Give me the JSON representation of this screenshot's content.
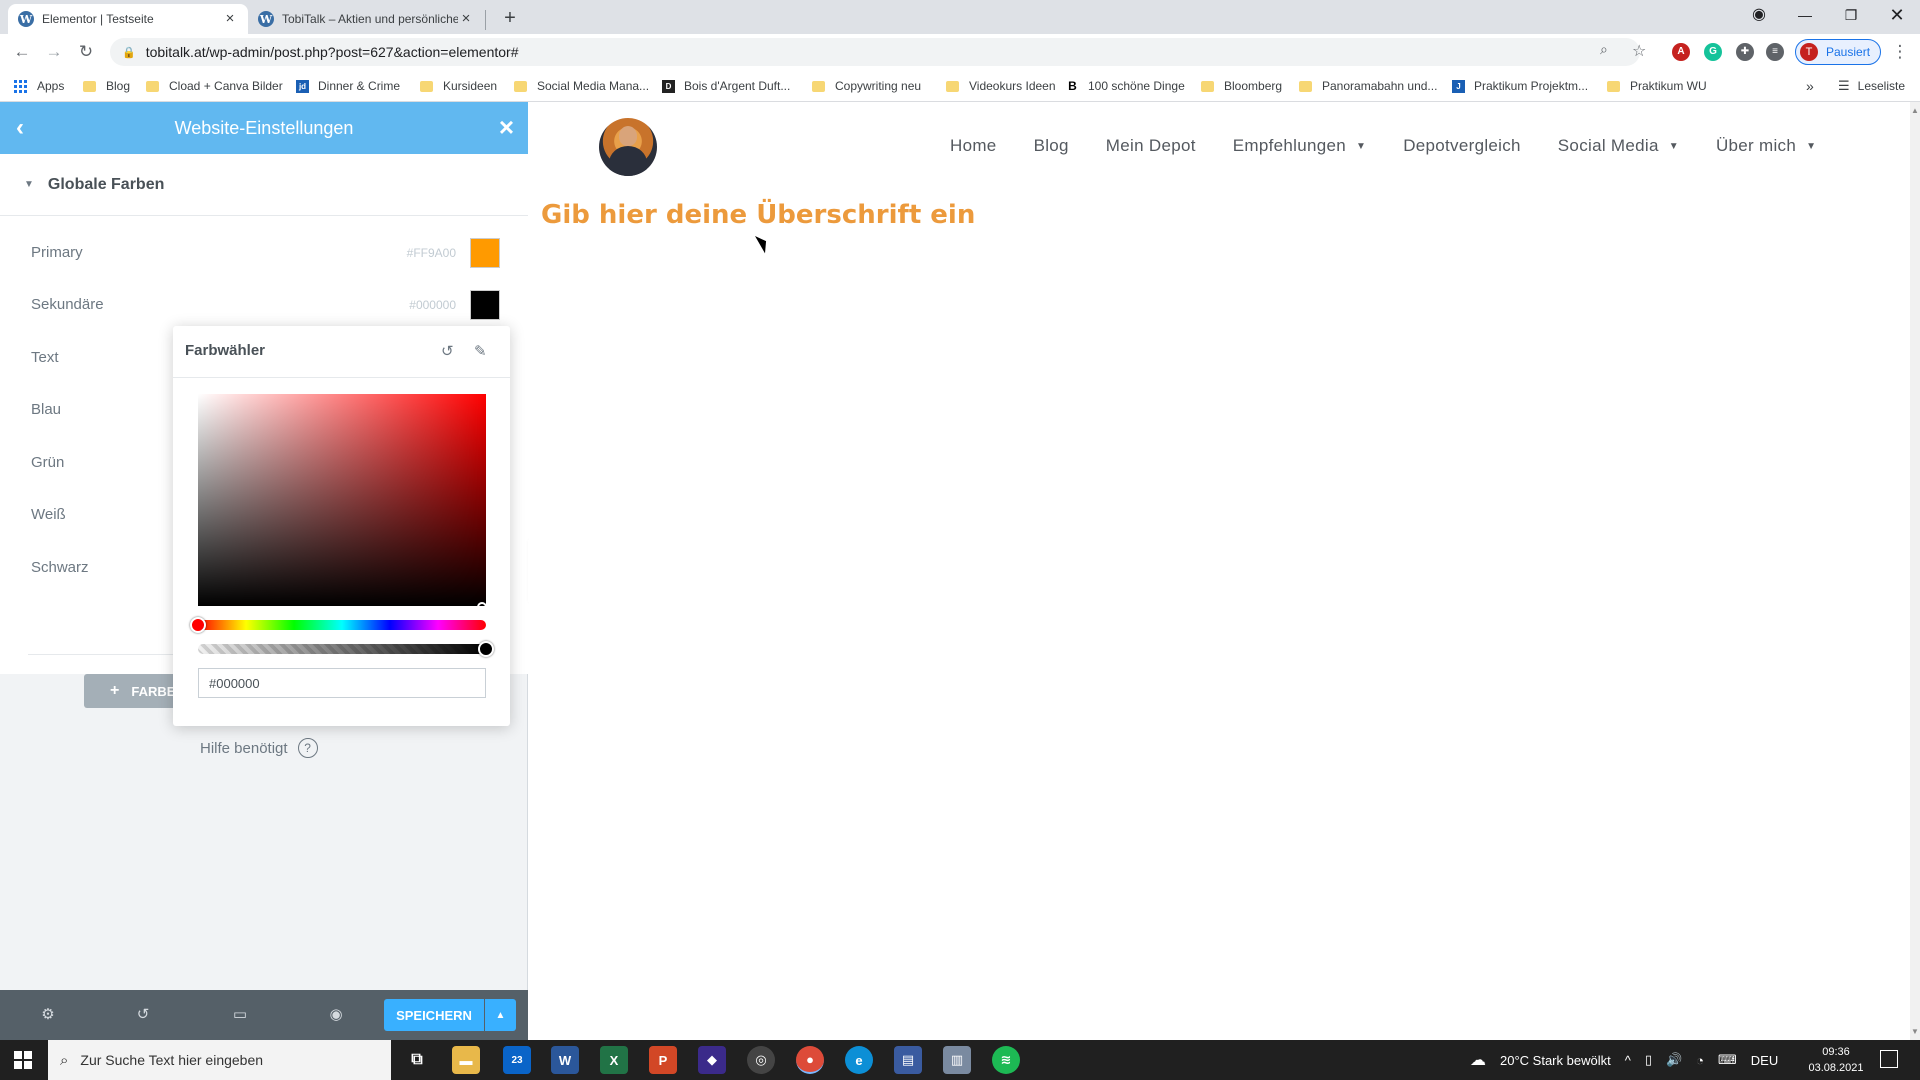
{
  "browser": {
    "tabs": [
      {
        "title": "Elementor | Testseite",
        "active": true
      },
      {
        "title": "TobiTalk – Aktien und persönliche",
        "active": false
      }
    ],
    "new_tab": "+",
    "url": "tobitalk.at/wp-admin/post.php?post=627&action=elementor#",
    "profile_initial": "T",
    "profile_label": "Pausiert",
    "reading_list": "Leseliste",
    "more_bookmarks": "»",
    "bookmarks": [
      {
        "label": "Apps",
        "icon": "apps-grid-icon"
      },
      {
        "label": "Blog",
        "icon": "folder-icon"
      },
      {
        "label": "Cload + Canva Bilder",
        "icon": "folder-icon"
      },
      {
        "label": "Dinner & Crime",
        "icon": "jd-icon"
      },
      {
        "label": "Kursideen",
        "icon": "folder-icon"
      },
      {
        "label": "Social Media Mana...",
        "icon": "folder-icon"
      },
      {
        "label": "Bois d'Argent Duft...",
        "icon": "dior-icon"
      },
      {
        "label": "Copywriting neu",
        "icon": "folder-icon"
      },
      {
        "label": "Videokurs Ideen",
        "icon": "folder-icon"
      },
      {
        "label": "100 schöne Dinge",
        "icon": "b-icon"
      },
      {
        "label": "Bloomberg",
        "icon": "folder-icon"
      },
      {
        "label": "Panoramabahn und...",
        "icon": "folder-icon"
      },
      {
        "label": "Praktikum Projektm...",
        "icon": "j-icon"
      },
      {
        "label": "Praktikum WU",
        "icon": "folder-icon"
      }
    ]
  },
  "panel": {
    "title": "Website-Einstellungen",
    "section_title": "Globale Farben",
    "colors": [
      {
        "name": "Primary",
        "hex": "#FF9A00",
        "swatch": "#FF9A00"
      },
      {
        "name": "Sekundäre",
        "hex": "#000000",
        "swatch": "#000000"
      },
      {
        "name": "Text"
      },
      {
        "name": "Blau"
      },
      {
        "name": "Grün"
      },
      {
        "name": "Weiß"
      },
      {
        "name": "Schwarz"
      }
    ],
    "add_color_label": "FARBE",
    "help_label": "Hilfe benötigt",
    "save_label": "SPEICHERN",
    "accent": "#61B8F0"
  },
  "picker": {
    "title": "Farbwähler",
    "hex_value": "#000000",
    "hue_color": "#FF0000"
  },
  "site": {
    "nav": [
      {
        "label": "Home",
        "dropdown": false
      },
      {
        "label": "Blog",
        "dropdown": false
      },
      {
        "label": "Mein Depot",
        "dropdown": false
      },
      {
        "label": "Empfehlungen",
        "dropdown": true
      },
      {
        "label": "Depotvergleich",
        "dropdown": false
      },
      {
        "label": "Social Media",
        "dropdown": true
      },
      {
        "label": "Über mich",
        "dropdown": true
      }
    ],
    "headline": "Gib hier deine Überschrift ein",
    "headline_color": "#EC9A3C"
  },
  "taskbar": {
    "search_placeholder": "Zur Suche Text hier eingeben",
    "mail_badge": "23",
    "weather": "20°C  Stark bewölkt",
    "lang": "DEU",
    "time": "09:36",
    "date": "03.08.2021"
  }
}
